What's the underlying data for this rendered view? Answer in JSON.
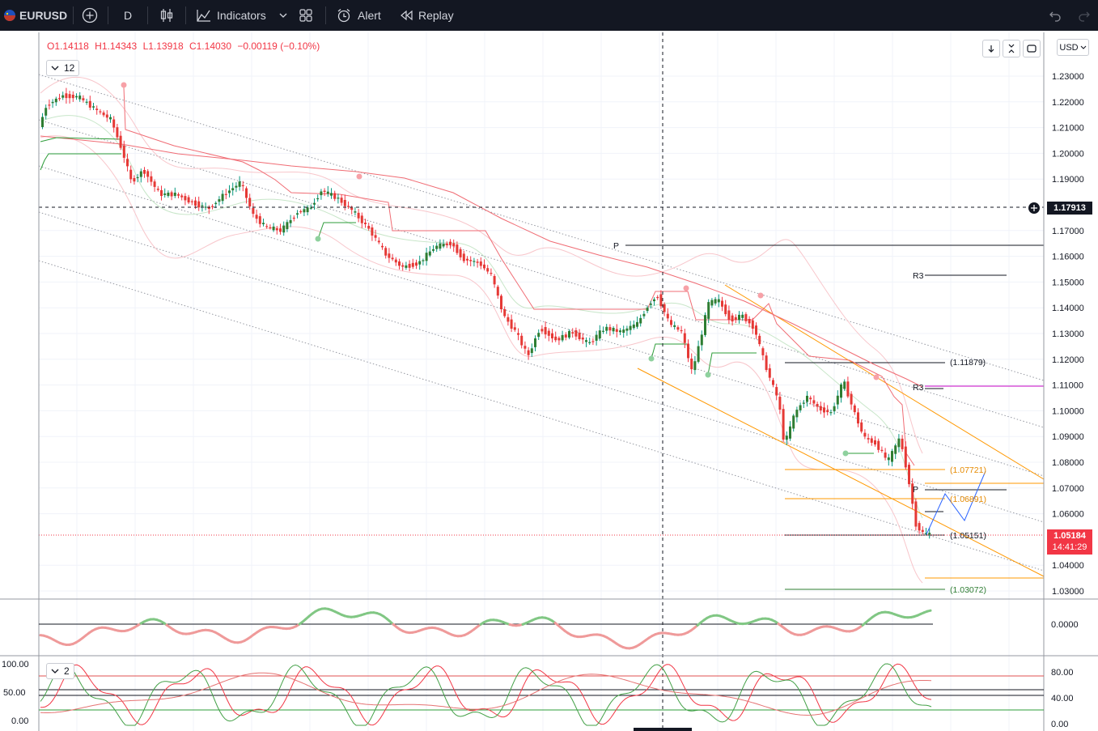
{
  "toolbar": {
    "symbol": "EURUSD",
    "interval": "D",
    "indicators_label": "Indicators",
    "alert_label": "Alert",
    "replay_label": "Replay"
  },
  "legend": {
    "open": "O1.14118",
    "high": "H1.14343",
    "low": "L1.13918",
    "close": "C1.14030",
    "change": "−0.00119 (−0.10%)",
    "indicator_count": "12"
  },
  "osc2_count": "2",
  "currency": "USD",
  "price_axis": {
    "ticks": [
      "1.23000",
      "1.22000",
      "1.21000",
      "1.20000",
      "1.19000",
      "1.17000",
      "1.16000",
      "1.15000",
      "1.14000",
      "1.13000",
      "1.12000",
      "1.11000",
      "1.10000",
      "1.09000",
      "1.08000",
      "1.07000",
      "1.06000",
      "1.04000",
      "1.03000"
    ],
    "crosshair_price": "1.17913",
    "last_price": "1.05184",
    "countdown": "14:41:29"
  },
  "levels": {
    "p_upper": "P",
    "r3_upper": "R3",
    "r3_lower": "R3",
    "p_lower": "P",
    "l1": "(1.11879)",
    "l2": "(1.07721)",
    "l3": "(1.06891)",
    "l4": "(1.05151)",
    "l5": "(1.03072)"
  },
  "osc1_axis": {
    "zero": "0.0000"
  },
  "osc2_axis": {
    "left": [
      "100.00",
      "50.00",
      "0.00"
    ],
    "right": [
      "80.00",
      "40.00",
      "0.00"
    ]
  },
  "colors": {
    "bull": "#089981",
    "bear": "#f23645",
    "accent": "#2962ff",
    "bg_dark": "#131722"
  }
}
